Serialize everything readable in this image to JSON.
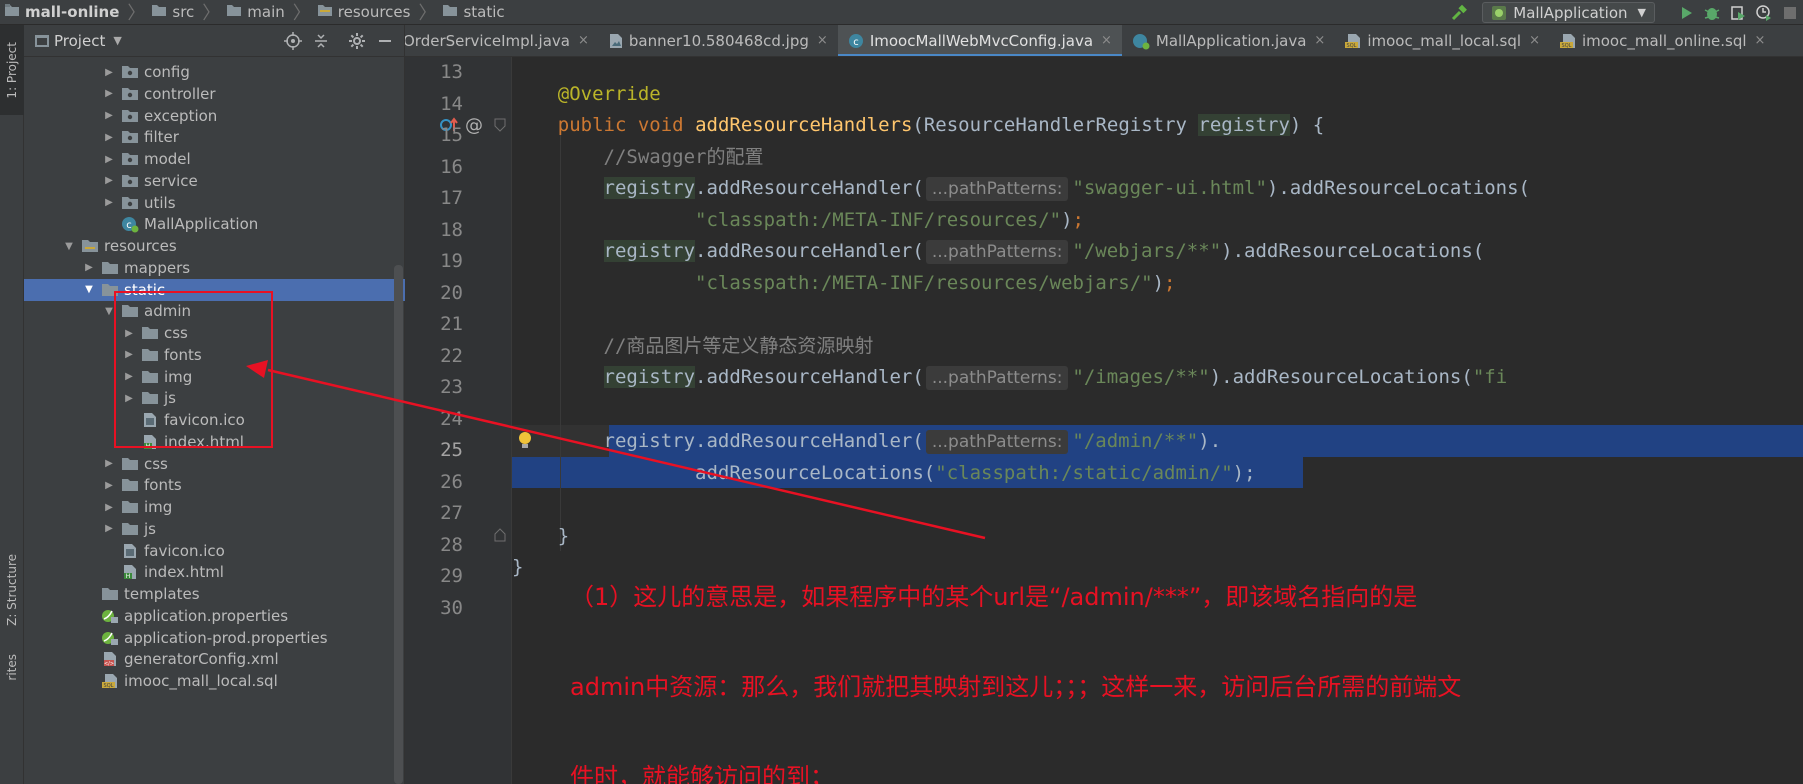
{
  "breadcrumb": [
    {
      "label": "mall-online"
    },
    {
      "label": "src"
    },
    {
      "label": "main"
    },
    {
      "label": "resources"
    },
    {
      "label": "static"
    }
  ],
  "toolbar": {
    "run_config": "MallApplication"
  },
  "left_strip": {
    "project_tab": "1: Project",
    "structure_tab": "Z: Structure",
    "favorites_tab": "rites"
  },
  "project_panel": {
    "title": "Project",
    "tree": [
      {
        "label": "config",
        "depth": 3,
        "kind": "package",
        "expanded": false
      },
      {
        "label": "controller",
        "depth": 3,
        "kind": "package",
        "expanded": false
      },
      {
        "label": "exception",
        "depth": 3,
        "kind": "package",
        "expanded": false
      },
      {
        "label": "filter",
        "depth": 3,
        "kind": "package",
        "expanded": false
      },
      {
        "label": "model",
        "depth": 3,
        "kind": "package",
        "expanded": false
      },
      {
        "label": "service",
        "depth": 3,
        "kind": "package",
        "expanded": false
      },
      {
        "label": "utils",
        "depth": 3,
        "kind": "package",
        "expanded": false
      },
      {
        "label": "MallApplication",
        "depth": 3,
        "kind": "spring-class"
      },
      {
        "label": "resources",
        "depth": 1,
        "kind": "resources-folder",
        "expanded": true
      },
      {
        "label": "mappers",
        "depth": 2,
        "kind": "folder",
        "expanded": false
      },
      {
        "label": "static",
        "depth": 2,
        "kind": "folder",
        "expanded": true,
        "selected": true
      },
      {
        "label": "admin",
        "depth": 3,
        "kind": "folder",
        "expanded": true
      },
      {
        "label": "css",
        "depth": 4,
        "kind": "folder",
        "expanded": false
      },
      {
        "label": "fonts",
        "depth": 4,
        "kind": "folder",
        "expanded": false
      },
      {
        "label": "img",
        "depth": 4,
        "kind": "folder",
        "expanded": false
      },
      {
        "label": "js",
        "depth": 4,
        "kind": "folder",
        "expanded": false
      },
      {
        "label": "favicon.ico",
        "depth": 4,
        "kind": "file"
      },
      {
        "label": "index.html",
        "depth": 4,
        "kind": "html"
      },
      {
        "label": "css",
        "depth": 3,
        "kind": "folder",
        "expanded": false
      },
      {
        "label": "fonts",
        "depth": 3,
        "kind": "folder",
        "expanded": false
      },
      {
        "label": "img",
        "depth": 3,
        "kind": "folder",
        "expanded": false
      },
      {
        "label": "js",
        "depth": 3,
        "kind": "folder",
        "expanded": false
      },
      {
        "label": "favicon.ico",
        "depth": 3,
        "kind": "file"
      },
      {
        "label": "index.html",
        "depth": 3,
        "kind": "html"
      },
      {
        "label": "templates",
        "depth": 2,
        "kind": "folder"
      },
      {
        "label": "application.properties",
        "depth": 2,
        "kind": "spring-props"
      },
      {
        "label": "application-prod.properties",
        "depth": 2,
        "kind": "spring-props"
      },
      {
        "label": "generatorConfig.xml",
        "depth": 2,
        "kind": "xml"
      },
      {
        "label": "imooc_mall_local.sql",
        "depth": 2,
        "kind": "sql"
      }
    ]
  },
  "tabs": [
    {
      "label": "OrderServiceImpl.java",
      "icon": "java",
      "active": false
    },
    {
      "label": "banner10.580468cd.jpg",
      "icon": "image",
      "active": false
    },
    {
      "label": "ImoocMallWebMvcConfig.java",
      "icon": "class",
      "active": true
    },
    {
      "label": "MallApplication.java",
      "icon": "spring",
      "active": false
    },
    {
      "label": "imooc_mall_local.sql",
      "icon": "sql",
      "active": false
    },
    {
      "label": "imooc_mall_online.sql",
      "icon": "sql",
      "active": false
    }
  ],
  "editor": {
    "lines": [
      "13",
      "14",
      "15",
      "16",
      "17",
      "18",
      "19",
      "20",
      "21",
      "22",
      "23",
      "24",
      "25",
      "26",
      "27",
      "28",
      "29",
      "30"
    ],
    "current_line": "25",
    "code": {
      "l14_annotation": "@Override",
      "l15_public": "public",
      "l15_void": "void",
      "l15_method": "addResourceHandlers",
      "l15_params_a": "(ResourceHandlerRegistry ",
      "l15_param": "registry",
      "l15_params_b": ") {",
      "l16_comment": "//Swagger的配置",
      "registry": "registry",
      "add_handler_open": ".addResourceHandler(",
      "hint": "...pathPatterns:",
      "l17_str": "\"swagger-ui.html\"",
      "l17_tail": ").addResourceLocations(",
      "l18_str": "\"classpath:/META-INF/resources/\"",
      "close_semicolon_a": ")",
      "close_semicolon_b": ";",
      "l19_str": "\"/webjars/**\"",
      "l19_tail": ").addResourceLocations(",
      "l20_str": "\"classpath:/META-INF/resources/webjars/\"",
      "l22_comment": "//商品图片等定义静态资源映射",
      "l23_str": "\"/images/**\"",
      "l23_tail": ").addResourceLocations(",
      "l23_str_cut": "\"fi",
      "l25_str": "\"/admin/**\"",
      "l25_tail": ").",
      "l26_head": "addResourceLocations(",
      "l26_str": "\"classpath:/static/admin/\"",
      "l26_tail": ");",
      "l28_brace": "}",
      "l29_brace": "}"
    }
  },
  "annotation": {
    "note_line1": "（1）这儿的意思是，如果程序中的某个url是“/admin/***”，即该域名指向的是",
    "note_line2": "admin中资源：那么，我们就把其映射到这儿；；；这样一来，访问后台所需的前端文",
    "note_line3": "件时，就能够访问的到；",
    "color": "#e81123"
  },
  "colors": {
    "selection": "#214283",
    "tree_selection": "#4b6eaf",
    "panel_bg": "#3c3f41",
    "editor_bg": "#2b2b2b"
  }
}
